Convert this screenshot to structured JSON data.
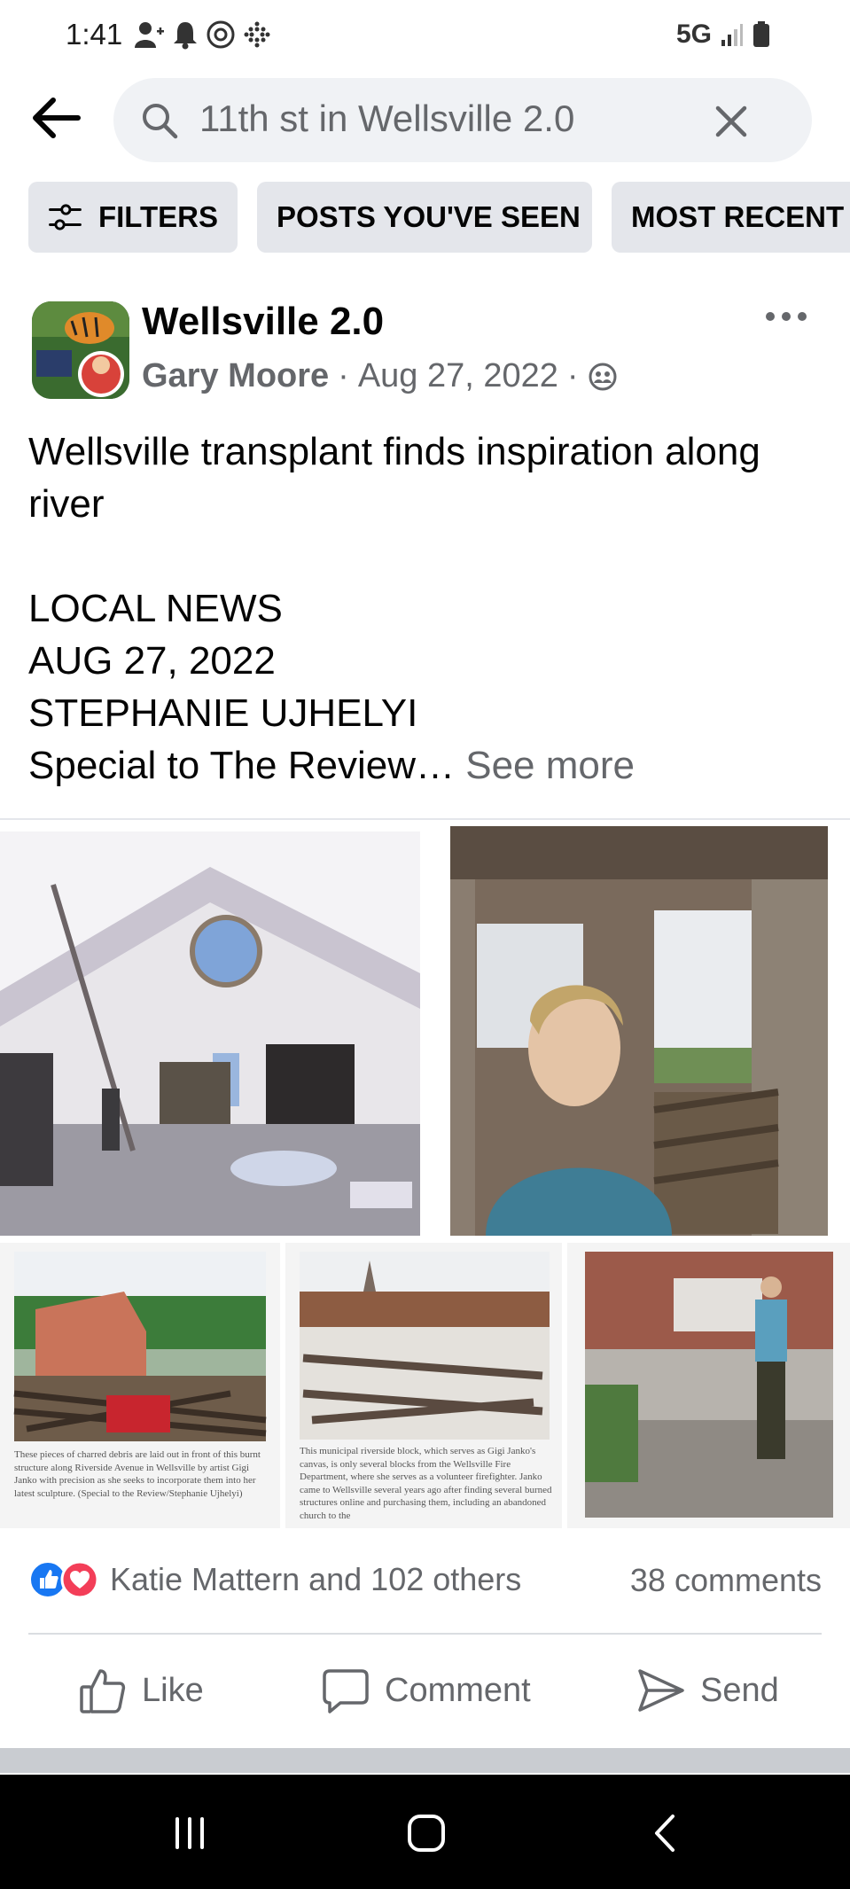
{
  "status_bar": {
    "time": "1:41",
    "network": "5G"
  },
  "search": {
    "query": "11th st in Wellsville 2.0"
  },
  "filters": [
    {
      "label": "FILTERS"
    },
    {
      "label": "POSTS YOU'VE SEEN"
    },
    {
      "label": "MOST RECENT"
    }
  ],
  "post": {
    "group": "Wellsville 2.0",
    "author": "Gary Moore",
    "separator": "·",
    "date": "Aug 27, 2022",
    "lines": [
      "Wellsville transplant finds inspiration along river",
      "",
      "LOCAL NEWS",
      "AUG 27, 2022",
      "STEPHANIE UJHELYI"
    ],
    "last_line": "Special to The Review…",
    "see_more": "See more"
  },
  "captions": [
    "These pieces of charred debris are laid out in front of this burnt structure along Riverside Avenue in Wellsville by artist Gigi Janko with precision as she seeks to incorporate them into her latest sculpture. (Special to the Review/Stephanie Ujhelyi)",
    "This municipal riverside block, which serves as Gigi Janko's canvas, is only several blocks from the Wellsville Fire Department, where she serves as a volunteer firefighter. Janko came to Wellsville several years ago after finding several burned structures online and purchasing them, including an abandoned church to the"
  ],
  "reactions": {
    "text": "Katie Mattern and 102 others",
    "comments": "38 comments"
  },
  "actions": [
    {
      "label": "Like",
      "icon": "thumbs-up-icon"
    },
    {
      "label": "Comment",
      "icon": "comment-icon"
    },
    {
      "label": "Send",
      "icon": "send-icon"
    }
  ],
  "colors": {
    "like_blue": "#1877f2",
    "love_red": "#f33e58",
    "secondary_text": "#65676b",
    "chip_bg": "#e4e6eb"
  }
}
